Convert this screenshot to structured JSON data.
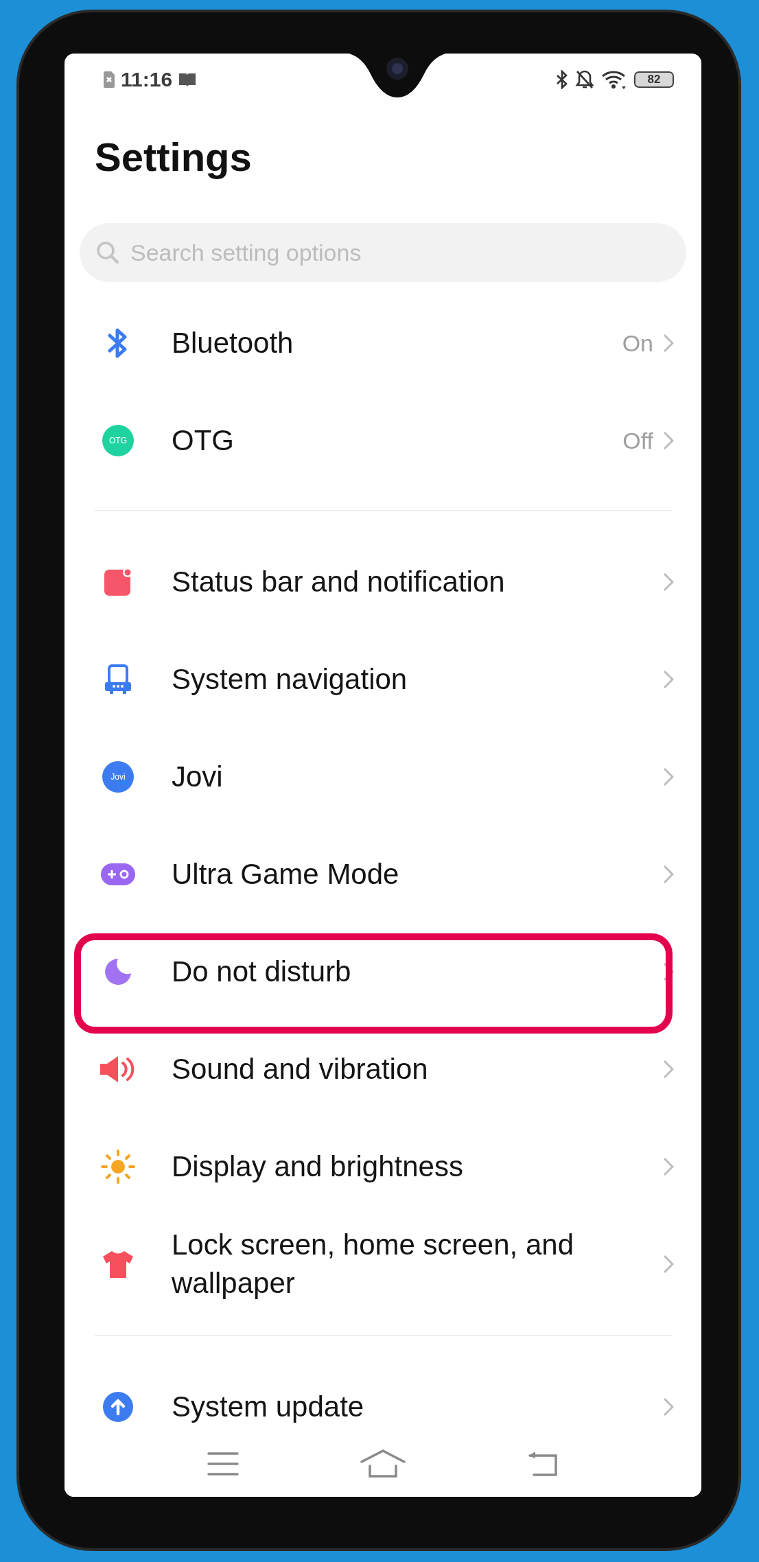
{
  "status_bar": {
    "time": "11:16",
    "battery": "82"
  },
  "title": "Settings",
  "search": {
    "placeholder": "Search setting options"
  },
  "sections": [
    {
      "items": [
        {
          "label": "Bluetooth",
          "value": "On",
          "highlighted": false
        },
        {
          "label": "OTG",
          "icon_text": "OTG",
          "value": "Off",
          "highlighted": false
        }
      ]
    },
    {
      "items": [
        {
          "label": "Status bar and notification",
          "highlighted": false
        },
        {
          "label": "System navigation",
          "highlighted": false
        },
        {
          "label": "Jovi",
          "icon_text": "Jovi",
          "highlighted": false
        },
        {
          "label": "Ultra Game Mode",
          "highlighted": false
        },
        {
          "label": "Do not disturb",
          "highlighted": true
        },
        {
          "label": "Sound and vibration",
          "highlighted": false
        },
        {
          "label": "Display and brightness",
          "highlighted": false
        },
        {
          "label": "Lock screen, home screen, and wallpaper",
          "highlighted": false
        }
      ]
    },
    {
      "items": [
        {
          "label": "System update",
          "highlighted": false
        }
      ]
    }
  ]
}
